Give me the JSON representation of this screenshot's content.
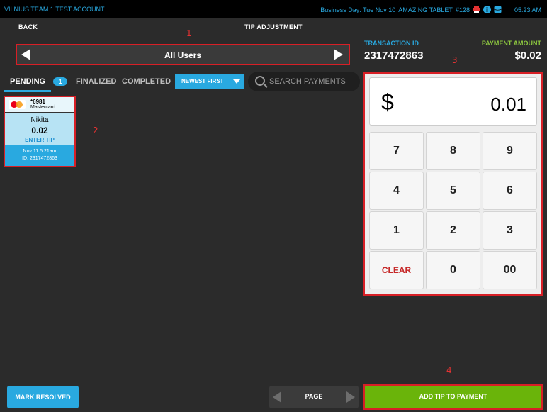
{
  "topbar": {
    "account": "VILNIUS TEAM 1 TEST ACCOUNT",
    "business_day": "Business Day: Tue Nov 10",
    "device": "AMAZING TABLET",
    "device_number": "#128",
    "time": "05:23 AM",
    "icons": [
      "printer-icon",
      "info-icon",
      "database-icon"
    ]
  },
  "nav": {
    "back": "BACK",
    "title": "TIP ADJUSTMENT"
  },
  "annotations": [
    "1",
    "2",
    "3",
    "4"
  ],
  "user_selector": {
    "label": "All Users"
  },
  "transaction": {
    "id_label": "TRANSACTION ID",
    "id": "2317472863",
    "amount_label": "PAYMENT AMOUNT",
    "amount": "$0.02"
  },
  "tabs": {
    "pending": "PENDING",
    "pending_count": "1",
    "finalized": "FINALIZED",
    "completed": "COMPLETED",
    "sort": "NEWEST FIRST",
    "search_placeholder": "SEARCH PAYMENTS"
  },
  "payment_card": {
    "last4": "*6981",
    "brand": "Mastercard",
    "customer": "Nikita",
    "amount": "0.02",
    "action": "ENTER TIP",
    "date": "Nov 11 5:21am",
    "id": "ID: 2317472863"
  },
  "keypad": {
    "currency": "$",
    "value": "0.01",
    "keys": [
      "7",
      "8",
      "9",
      "4",
      "5",
      "6",
      "1",
      "2",
      "3",
      "CLEAR",
      "0",
      "00"
    ]
  },
  "footer": {
    "mark_resolved": "MARK RESOLVED",
    "page": "PAGE",
    "add_tip": "ADD TIP TO PAYMENT"
  },
  "colors": {
    "accent": "#29a9e0",
    "green": "#6ab40a",
    "amount_label": "#8cc63f",
    "highlight": "#d81f26"
  }
}
